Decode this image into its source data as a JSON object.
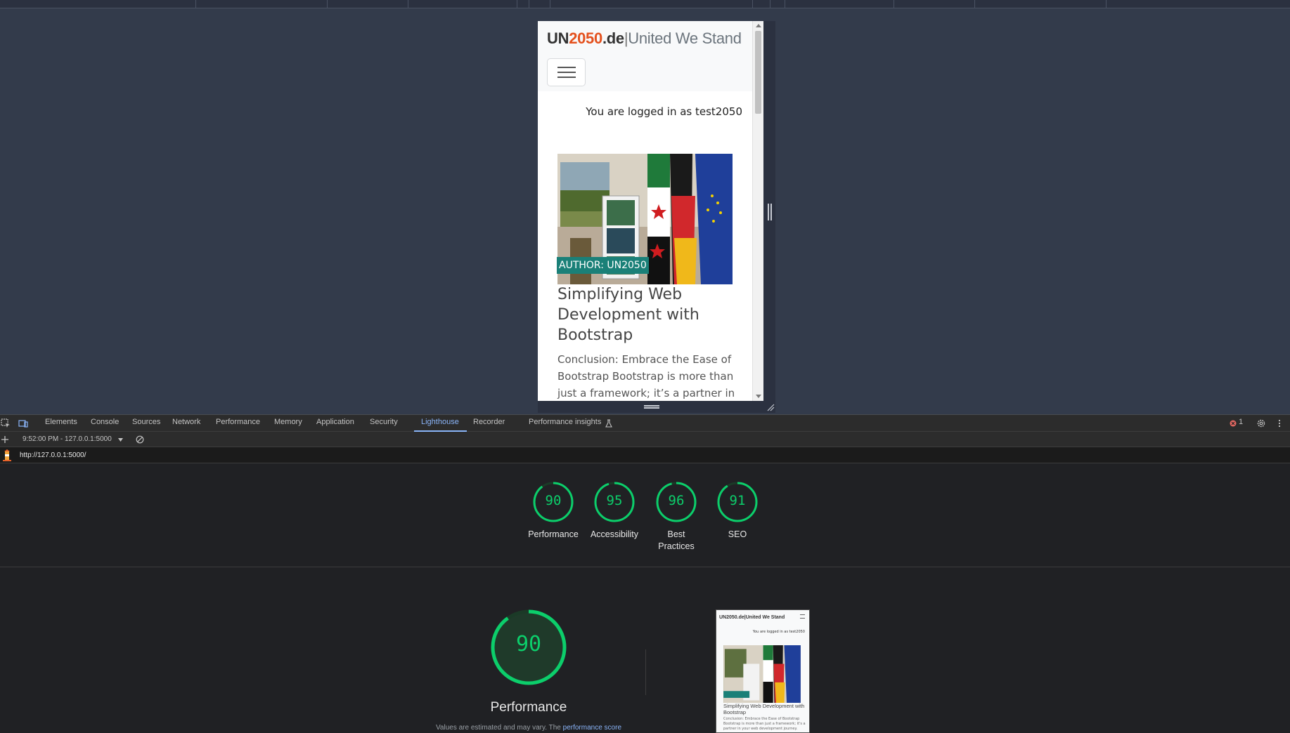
{
  "site": {
    "brand_un": "UN",
    "brand_year": "2050",
    "brand_tld": ".de",
    "brand_sep": "|",
    "brand_tagline": "United We Stand",
    "logged_in_text": "You are logged in as test2050",
    "post": {
      "author_badge": "AUTHOR: UN2050",
      "title": "Simplifying Web Development with Bootstrap",
      "excerpt": "Conclusion: Embrace the Ease of Bootstrap Bootstrap is more than just a framework; it’s a partner in"
    }
  },
  "devtools": {
    "tabs": [
      "Elements",
      "Console",
      "Sources",
      "Network",
      "Performance",
      "Memory",
      "Application",
      "Security",
      "Lighthouse",
      "Recorder",
      "Performance insights"
    ],
    "active_tab": "Lighthouse",
    "error_count": "1",
    "report_selector": "9:52:00 PM - 127.0.0.1:5000",
    "url": "http://127.0.0.1:5000/",
    "scores": [
      {
        "label": "Performance",
        "value": 90
      },
      {
        "label": "Accessibility",
        "value": 95
      },
      {
        "label": "Best Practices",
        "value": 96
      },
      {
        "label": "SEO",
        "value": 91
      }
    ],
    "main_score": {
      "label": "Performance",
      "value": 90
    },
    "note_prefix": "Values are estimated and may vary. The ",
    "note_link": "performance score",
    "score_color": "#0cce6b"
  },
  "thumbnail": {
    "brand": "UN2050.de|United We Stand",
    "login": "You are logged in as test2050",
    "badge": "AUTHOR: UN2050",
    "title": "Simplifying Web Development with Bootstrap",
    "excerpt": "Conclusion: Embrace the Ease of Bootstrap Bootstrap is more than just a framework; it's a partner in your web development journey."
  }
}
